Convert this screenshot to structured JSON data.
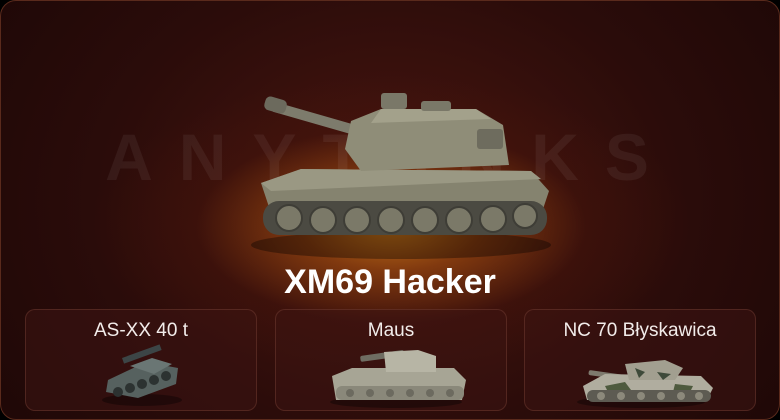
{
  "watermark": "ANYTANKS",
  "featured": {
    "name": "XM69 Hacker",
    "icon": "tank-xm69-icon"
  },
  "rewards": [
    {
      "name": "AS-XX 40 t",
      "icon": "tank-as-xx-40t-icon"
    },
    {
      "name": "Maus",
      "icon": "tank-maus-icon"
    },
    {
      "name": "NC 70 Błyskawica",
      "icon": "tank-nc70-icon"
    }
  ],
  "colors": {
    "accent": "#c8781a",
    "background": "#2b0c0a",
    "border": "#5a2a1c"
  }
}
